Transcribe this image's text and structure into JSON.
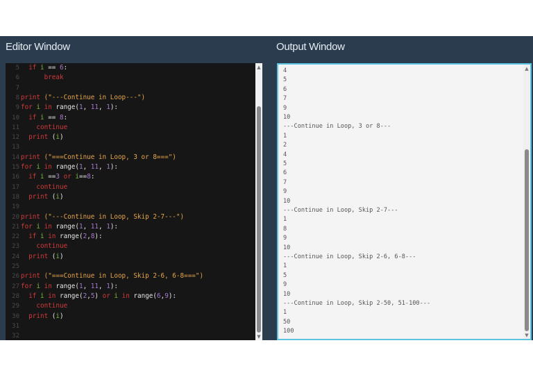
{
  "editor": {
    "title": "Editor Window",
    "lines": [
      {
        "n": "5",
        "t": [
          [
            "  ",
            "pl"
          ],
          [
            "if ",
            "kw"
          ],
          [
            "i",
            "vr"
          ],
          [
            " == ",
            "pl"
          ],
          [
            "6",
            "nm"
          ],
          [
            ":",
            "pl"
          ]
        ]
      },
      {
        "n": "6",
        "t": [
          [
            "      ",
            "pl"
          ],
          [
            "break",
            "kw"
          ]
        ]
      },
      {
        "n": "7",
        "t": []
      },
      {
        "n": "8",
        "t": [
          [
            "print ",
            "kw"
          ],
          [
            "(\"---Continue in Loop---\")",
            "st"
          ]
        ]
      },
      {
        "n": "9",
        "t": [
          [
            "for ",
            "kw"
          ],
          [
            "i ",
            "vr"
          ],
          [
            "in ",
            "kw"
          ],
          [
            "range(",
            "pl"
          ],
          [
            "1",
            "nm"
          ],
          [
            ", ",
            "pl"
          ],
          [
            "11",
            "nm"
          ],
          [
            ", ",
            "pl"
          ],
          [
            "1",
            "nm"
          ],
          [
            "):",
            "pl"
          ]
        ]
      },
      {
        "n": "10",
        "t": [
          [
            "  ",
            "pl"
          ],
          [
            "if ",
            "kw"
          ],
          [
            "i",
            "vr"
          ],
          [
            " == ",
            "pl"
          ],
          [
            "8",
            "nm"
          ],
          [
            ":",
            "pl"
          ]
        ]
      },
      {
        "n": "11",
        "t": [
          [
            "    ",
            "pl"
          ],
          [
            "continue",
            "kw"
          ]
        ]
      },
      {
        "n": "12",
        "t": [
          [
            "  ",
            "pl"
          ],
          [
            "print ",
            "kw"
          ],
          [
            "(",
            "pl"
          ],
          [
            "i",
            "vr"
          ],
          [
            ")",
            "pl"
          ]
        ]
      },
      {
        "n": "13",
        "t": []
      },
      {
        "n": "14",
        "t": [
          [
            "print ",
            "kw"
          ],
          [
            "(\"===Continue in Loop, 3 or 8===\")",
            "st"
          ]
        ]
      },
      {
        "n": "15",
        "t": [
          [
            "for ",
            "kw"
          ],
          [
            "i ",
            "vr"
          ],
          [
            "in ",
            "kw"
          ],
          [
            "range(",
            "pl"
          ],
          [
            "1",
            "nm"
          ],
          [
            ", ",
            "pl"
          ],
          [
            "11",
            "nm"
          ],
          [
            ", ",
            "pl"
          ],
          [
            "1",
            "nm"
          ],
          [
            "):",
            "pl"
          ]
        ]
      },
      {
        "n": "16",
        "t": [
          [
            "  ",
            "pl"
          ],
          [
            "if ",
            "kw"
          ],
          [
            "i",
            "vr"
          ],
          [
            " ==",
            "pl"
          ],
          [
            "3",
            "nm"
          ],
          [
            " or ",
            "kw"
          ],
          [
            "i",
            "vr"
          ],
          [
            "==",
            "pl"
          ],
          [
            "8",
            "nm"
          ],
          [
            ":",
            "pl"
          ]
        ]
      },
      {
        "n": "17",
        "t": [
          [
            "    ",
            "pl"
          ],
          [
            "continue",
            "kw"
          ]
        ]
      },
      {
        "n": "18",
        "t": [
          [
            "  ",
            "pl"
          ],
          [
            "print ",
            "kw"
          ],
          [
            "(",
            "pl"
          ],
          [
            "i",
            "vr"
          ],
          [
            ")",
            "pl"
          ]
        ]
      },
      {
        "n": "19",
        "t": []
      },
      {
        "n": "20",
        "t": [
          [
            "print ",
            "kw"
          ],
          [
            "(\"---Continue in Loop, Skip 2-7---\")",
            "st"
          ]
        ]
      },
      {
        "n": "21",
        "t": [
          [
            "for ",
            "kw"
          ],
          [
            "i ",
            "vr"
          ],
          [
            "in ",
            "kw"
          ],
          [
            "range(",
            "pl"
          ],
          [
            "1",
            "nm"
          ],
          [
            ", ",
            "pl"
          ],
          [
            "11",
            "nm"
          ],
          [
            ", ",
            "pl"
          ],
          [
            "1",
            "nm"
          ],
          [
            "):",
            "pl"
          ]
        ]
      },
      {
        "n": "22",
        "t": [
          [
            "  ",
            "pl"
          ],
          [
            "if ",
            "kw"
          ],
          [
            "i ",
            "vr"
          ],
          [
            "in ",
            "kw"
          ],
          [
            "range(",
            "pl"
          ],
          [
            "2",
            "nm"
          ],
          [
            ",",
            "pl"
          ],
          [
            "8",
            "nm"
          ],
          [
            "):",
            "pl"
          ]
        ]
      },
      {
        "n": "23",
        "t": [
          [
            "    ",
            "pl"
          ],
          [
            "continue",
            "kw"
          ]
        ]
      },
      {
        "n": "24",
        "t": [
          [
            "  ",
            "pl"
          ],
          [
            "print ",
            "kw"
          ],
          [
            "(",
            "pl"
          ],
          [
            "i",
            "vr"
          ],
          [
            ")",
            "pl"
          ]
        ]
      },
      {
        "n": "25",
        "t": []
      },
      {
        "n": "26",
        "t": [
          [
            "print ",
            "kw"
          ],
          [
            "(\"===Continue in Loop, Skip 2-6, 6-8===\")",
            "st"
          ]
        ]
      },
      {
        "n": "27",
        "t": [
          [
            "for ",
            "kw"
          ],
          [
            "i ",
            "vr"
          ],
          [
            "in ",
            "kw"
          ],
          [
            "range(",
            "pl"
          ],
          [
            "1",
            "nm"
          ],
          [
            ", ",
            "pl"
          ],
          [
            "11",
            "nm"
          ],
          [
            ", ",
            "pl"
          ],
          [
            "1",
            "nm"
          ],
          [
            "):",
            "pl"
          ]
        ]
      },
      {
        "n": "28",
        "t": [
          [
            "  ",
            "pl"
          ],
          [
            "if ",
            "kw"
          ],
          [
            "i ",
            "vr"
          ],
          [
            "in ",
            "kw"
          ],
          [
            "range(",
            "pl"
          ],
          [
            "2",
            "nm"
          ],
          [
            ",",
            "pl"
          ],
          [
            "5",
            "nm"
          ],
          [
            ") ",
            "pl"
          ],
          [
            "or ",
            "kw"
          ],
          [
            "i ",
            "vr"
          ],
          [
            "in ",
            "kw"
          ],
          [
            "range(",
            "pl"
          ],
          [
            "6",
            "nm"
          ],
          [
            ",",
            "pl"
          ],
          [
            "9",
            "nm"
          ],
          [
            "):",
            "pl"
          ]
        ]
      },
      {
        "n": "29",
        "t": [
          [
            "    ",
            "pl"
          ],
          [
            "continue",
            "kw"
          ]
        ]
      },
      {
        "n": "30",
        "t": [
          [
            "  ",
            "pl"
          ],
          [
            "print ",
            "kw"
          ],
          [
            "(",
            "pl"
          ],
          [
            "i",
            "vr"
          ],
          [
            ")",
            "pl"
          ]
        ]
      },
      {
        "n": "31",
        "t": []
      },
      {
        "n": "32",
        "t": []
      }
    ]
  },
  "output": {
    "title": "Output Window",
    "lines": [
      "4",
      "5",
      "6",
      "7",
      "9",
      "10",
      "---Continue in Loop, 3 or 8---",
      "1",
      "2",
      "4",
      "5",
      "6",
      "7",
      "9",
      "10",
      "---Continue in Loop, Skip 2-7---",
      "1",
      "8",
      "9",
      "10",
      "---Continue in Loop, Skip 2-6, 6-8---",
      "1",
      "5",
      "9",
      "10",
      "---Continue in Loop, Skip 2-50, 51-100---",
      "1",
      "50",
      "100"
    ]
  },
  "icons": {
    "scroll_up": "▲",
    "scroll_down": "▼"
  }
}
